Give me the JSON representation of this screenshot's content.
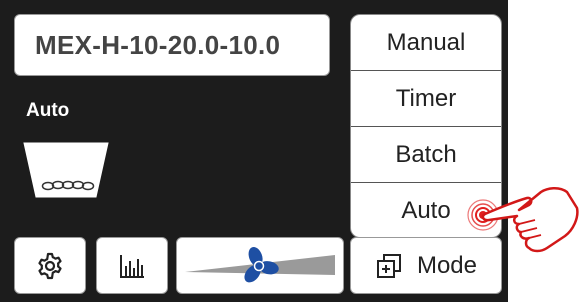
{
  "device": {
    "model_name": "MEX-H-10-20.0-10.0",
    "current_mode": "Auto"
  },
  "mode_menu": {
    "items": [
      {
        "label": "Manual"
      },
      {
        "label": "Timer"
      },
      {
        "label": "Batch"
      },
      {
        "label": "Auto"
      }
    ]
  },
  "toolbar": {
    "mode_label": "Mode",
    "settings_icon": "gear-icon",
    "chart_icon": "bar-chart-icon",
    "fan_icon": "fan-icon",
    "mode_icon": "layers-plus-icon"
  },
  "fan": {
    "speed_fraction": 0.45
  },
  "colors": {
    "screen_bg": "#1c1c1c",
    "fan_blue": "#1e4fa3",
    "tap_red": "#e02020"
  }
}
